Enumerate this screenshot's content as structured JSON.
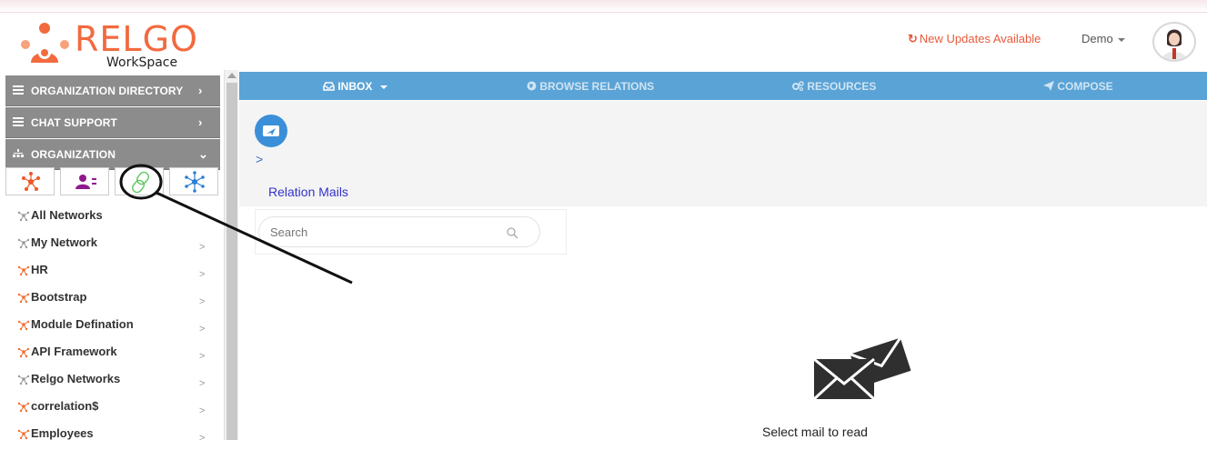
{
  "app": {
    "logo_text": "RELGO",
    "logo_sub": "WorkSpace",
    "updates_label": "New Updates Available",
    "user_label": "Demo"
  },
  "sidebar": {
    "sections": [
      {
        "label": "ORGANIZATION DIRECTORY",
        "chevron": "›",
        "icon": "list-icon"
      },
      {
        "label": "CHAT SUPPORT",
        "chevron": "›",
        "icon": "list-icon"
      },
      {
        "label": "ORGANIZATION",
        "chevron": "⌄",
        "icon": "org-tree-icon"
      }
    ],
    "icon_tabs": [
      {
        "name": "network-icon"
      },
      {
        "name": "users-icon"
      },
      {
        "name": "link-icon"
      },
      {
        "name": "hub-icon"
      }
    ],
    "items": [
      {
        "label": "All Networks",
        "star_color": "#9a9a9a",
        "has_arrow": false
      },
      {
        "label": "My Network",
        "star_color": "#9a9a9a",
        "has_arrow": true
      },
      {
        "label": "HR",
        "star_color": "#f07030",
        "has_arrow": true
      },
      {
        "label": "Bootstrap",
        "star_color": "#f07030",
        "has_arrow": true
      },
      {
        "label": "Module Defination",
        "star_color": "#f07030",
        "has_arrow": true
      },
      {
        "label": "API Framework",
        "star_color": "#f07030",
        "has_arrow": true
      },
      {
        "label": "Relgo Networks",
        "star_color": "#9a9a9a",
        "has_arrow": true
      },
      {
        "label": "correlation$",
        "star_color": "#f07030",
        "has_arrow": true
      },
      {
        "label": "Employees",
        "star_color": "#f07030",
        "has_arrow": true
      }
    ]
  },
  "navbar": {
    "tabs": [
      {
        "label": "INBOX",
        "icon": "inbox-icon",
        "active": true,
        "dropdown": true
      },
      {
        "label": "BROWSE RELATIONS",
        "icon": "globe-icon",
        "active": false
      },
      {
        "label": "RESOURCES",
        "icon": "cogs-icon",
        "active": false
      },
      {
        "label": "COMPOSE",
        "icon": "send-icon",
        "active": false
      }
    ]
  },
  "main": {
    "breadcrumb_chevron": ">",
    "folder_title": "Relation Mails",
    "search_placeholder": "Search",
    "empty_message": "Select mail to read"
  },
  "colors": {
    "brand": "#f26a3e",
    "navbar": "#5aa3d6",
    "sidebar_header": "#8c8c8c"
  }
}
